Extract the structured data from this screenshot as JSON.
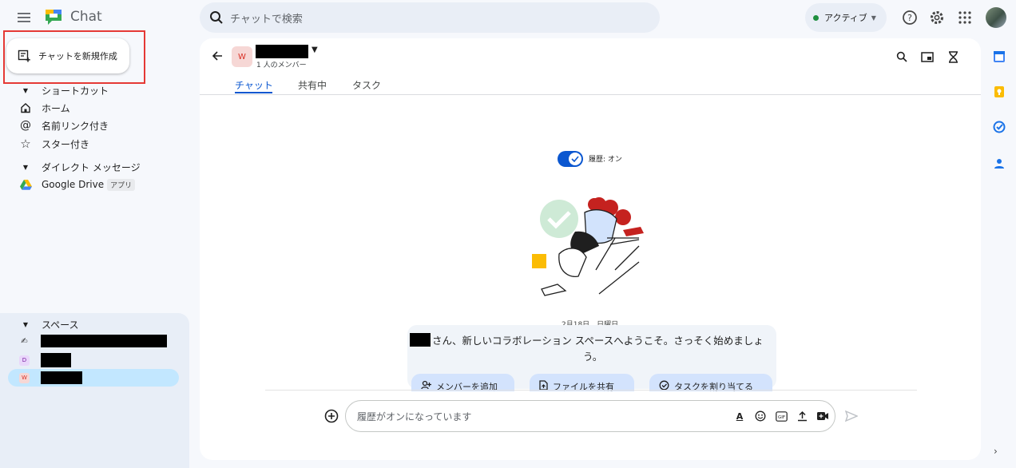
{
  "app": {
    "title": "Chat"
  },
  "search": {
    "placeholder": "チャットで検索"
  },
  "status": {
    "label": "アクティブ",
    "color": "#1e8e3e"
  },
  "sidebar": {
    "new_chat_label": "チャットを新規作成",
    "shortcuts_label": "ショートカット",
    "items": [
      {
        "label": "ホーム",
        "icon": "home-icon"
      },
      {
        "label": "名前リンク付き",
        "icon": "at-sign-icon"
      },
      {
        "label": "スター付き",
        "icon": "star-icon"
      }
    ],
    "dm_label": "ダイレクト メッセージ",
    "dm_items": [
      {
        "label": "Google Drive",
        "tag": "アプリ",
        "icon": "google-drive-icon"
      }
    ],
    "spaces_label": "スペース",
    "spaces": [
      {
        "badge": "✍",
        "icon": "writing-hand-icon",
        "active": false
      },
      {
        "badge": "D",
        "icon": "space-d-badge",
        "active": false
      },
      {
        "badge": "W",
        "icon": "space-w-badge",
        "active": true
      }
    ]
  },
  "space_header": {
    "avatar_letter": "W",
    "members": "1 人のメンバー",
    "tabs": [
      {
        "label": "チャット",
        "active": true
      },
      {
        "label": "共有中"
      },
      {
        "label": "タスク"
      }
    ]
  },
  "history": {
    "label": "履歴: オン"
  },
  "conversation": {
    "date": "2月18日、日曜日",
    "welcome_line1": "さん、新しいコラボレーション スペースへようこそ。さっそく始めましょ",
    "welcome_line2": "う。",
    "chips": [
      {
        "label": "メンバーを追加",
        "icon": "add-people-icon"
      },
      {
        "label": "ファイルを共有",
        "icon": "file-icon"
      },
      {
        "label": "タスクを割り当てる",
        "icon": "task-add-icon"
      }
    ]
  },
  "composer": {
    "placeholder": "履歴がオンになっています",
    "tools": [
      "format-text-icon",
      "emoji-icon",
      "gif-icon",
      "upload-icon",
      "video-meet-icon"
    ],
    "gif_label": "GIF",
    "format_label": "A"
  },
  "colors": {
    "accent": "#0b57d0",
    "space_active": "#c2e7ff",
    "danger_outline": "#e53935"
  }
}
